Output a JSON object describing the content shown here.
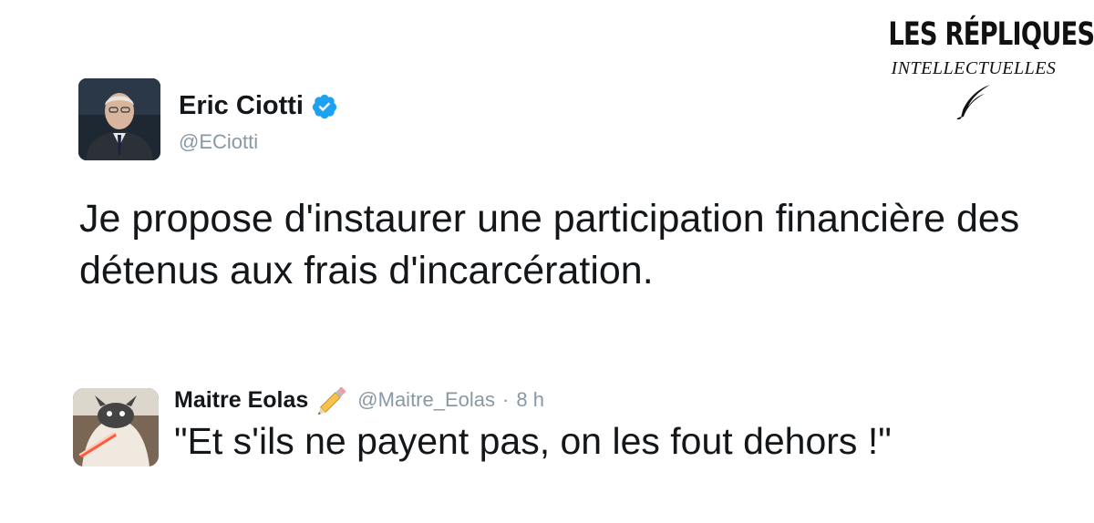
{
  "brand": {
    "title": "LES RÉPLIQUES",
    "subtitle": "INTELLECTUELLES",
    "icon": "quill-icon"
  },
  "main_tweet": {
    "author_name": "Eric Ciotti",
    "handle": "@ECiotti",
    "verified": true,
    "text": "Je propose d'instaurer une participation financière des détenus aux frais d'incarcération."
  },
  "reply_tweet": {
    "author_name": "Maitre Eolas",
    "author_emoji": "pencil-icon",
    "handle": "@Maitre_Eolas",
    "separator": "·",
    "time": "8 h",
    "text": "\"Et s'ils ne payent pas, on les fout dehors !\""
  },
  "colors": {
    "text": "#14171a",
    "muted": "#8899a6",
    "verified_blue": "#1da1f2"
  }
}
